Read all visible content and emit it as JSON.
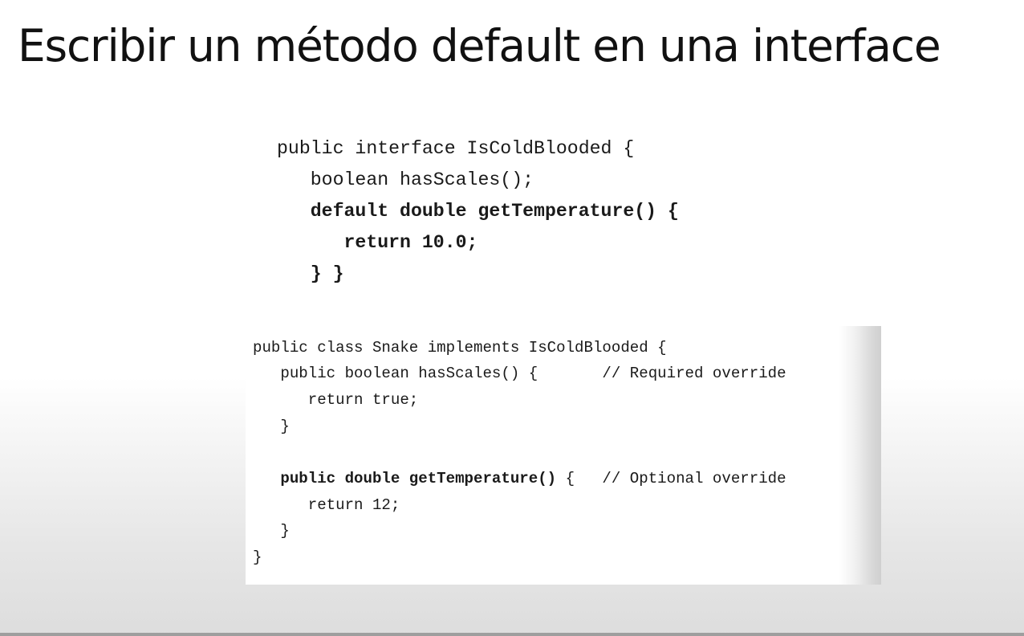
{
  "slide": {
    "title": "Escribir un método default en una interface"
  },
  "interface_code": {
    "lines": [
      "public interface IsColdBlooded {",
      "   boolean hasScales();",
      "   default double getTemperature() {",
      "      return 10.0;",
      "   } }"
    ]
  },
  "class_code": {
    "line0": "public class Snake implements IsColdBlooded {",
    "line1": "   public boolean hasScales() {       // Required override",
    "line2": "      return true;",
    "line3": "   }",
    "line4_bold": "   public double getTemperature()",
    "line4_rest": " {   // Optional override",
    "line5": "      return 12;",
    "line6": "   }",
    "line7": "}"
  }
}
